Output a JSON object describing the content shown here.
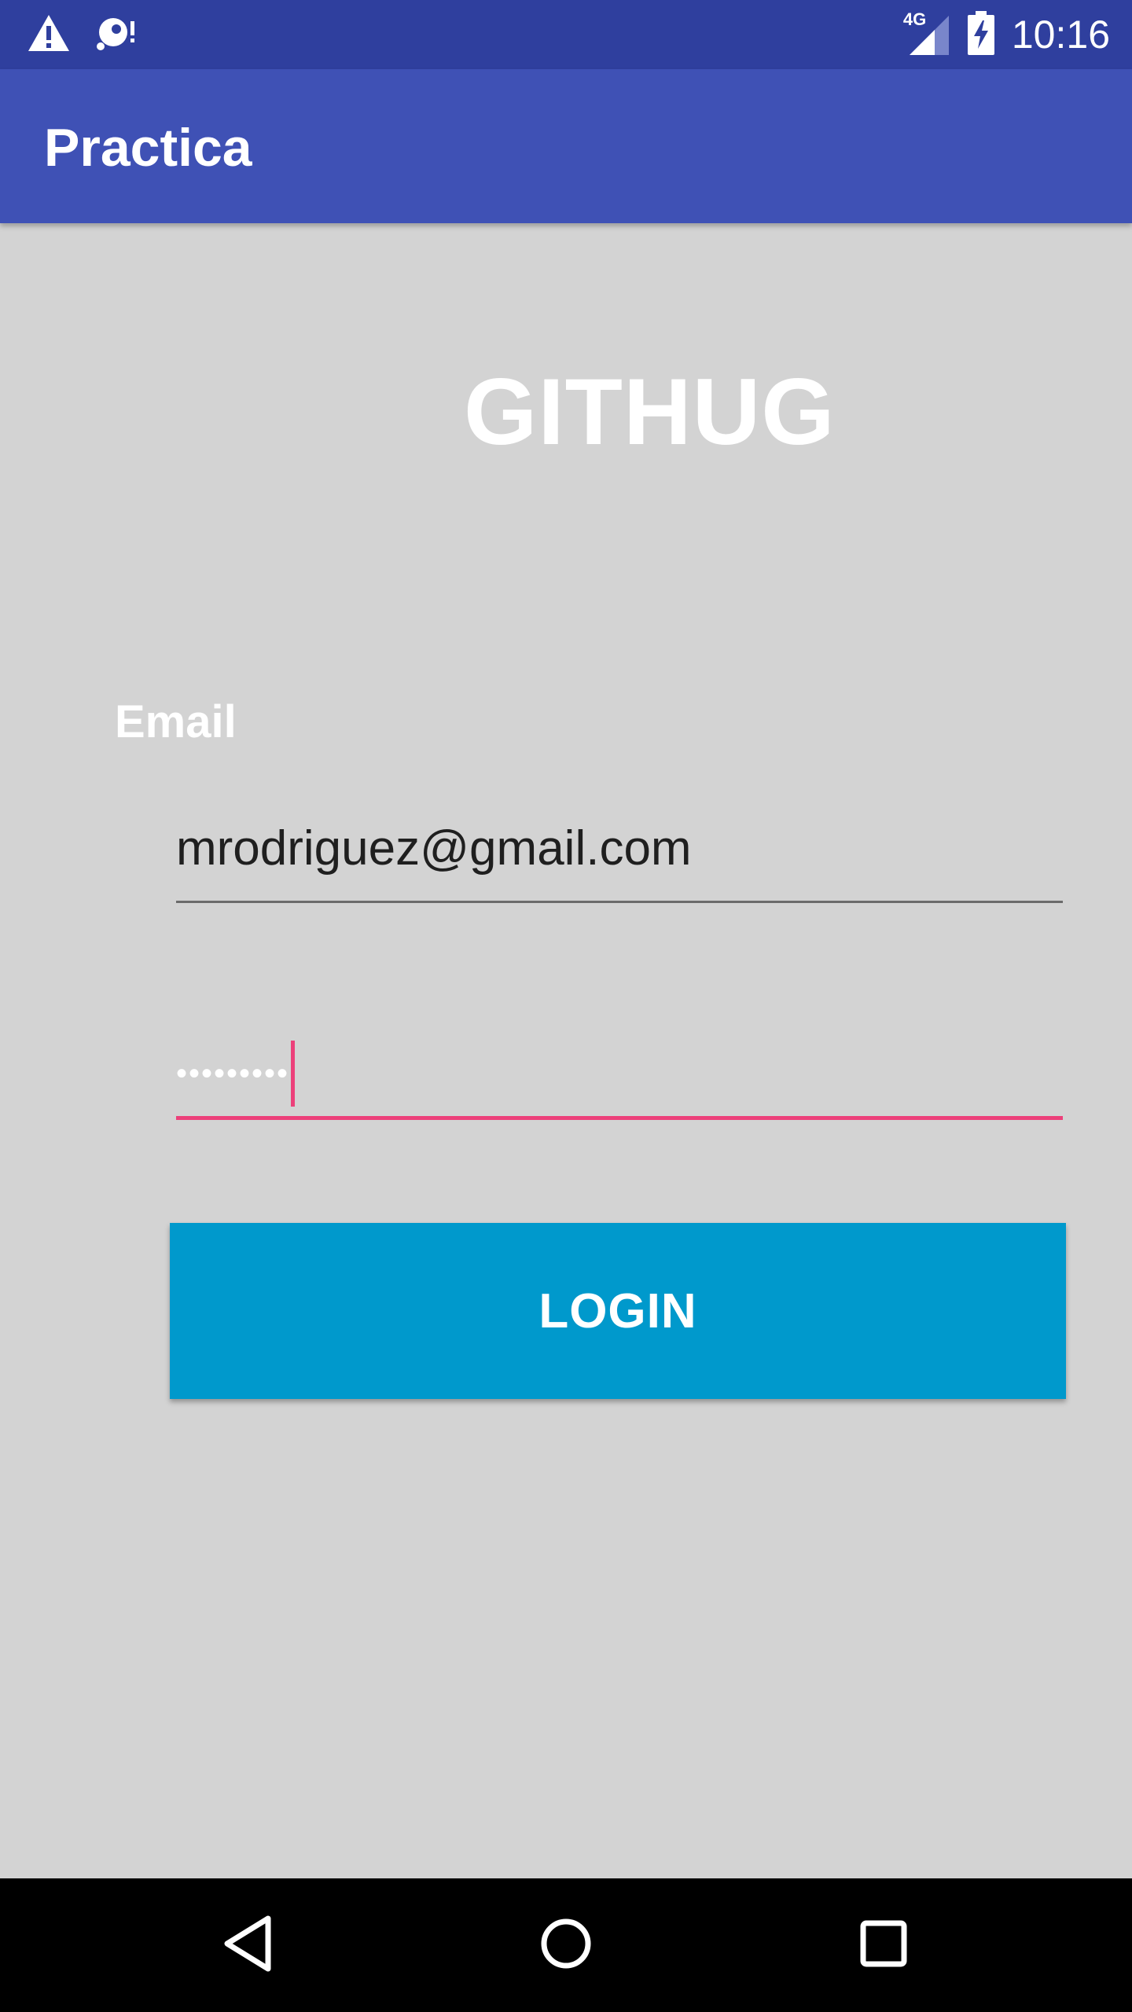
{
  "status_bar": {
    "time": "10:16",
    "network_type": "4G",
    "icons": [
      "warning-icon",
      "sd-card-alert-icon",
      "signal-icon",
      "battery-charging-icon"
    ]
  },
  "app_bar": {
    "title": "Practica"
  },
  "login": {
    "brand": "GITHUG",
    "email_label": "Email",
    "email_value": "mrodriguez@gmail.com",
    "password_mask": "•••••••••",
    "button_label": "LOGIN"
  },
  "navigation": {
    "icons": [
      "back-icon",
      "home-icon",
      "recents-icon"
    ]
  },
  "colors": {
    "status_bar": "#2f3f9e",
    "app_bar": "#3f51b5",
    "background": "#d3d3d3",
    "accent": "#ec407a",
    "button": "#0099cc"
  }
}
